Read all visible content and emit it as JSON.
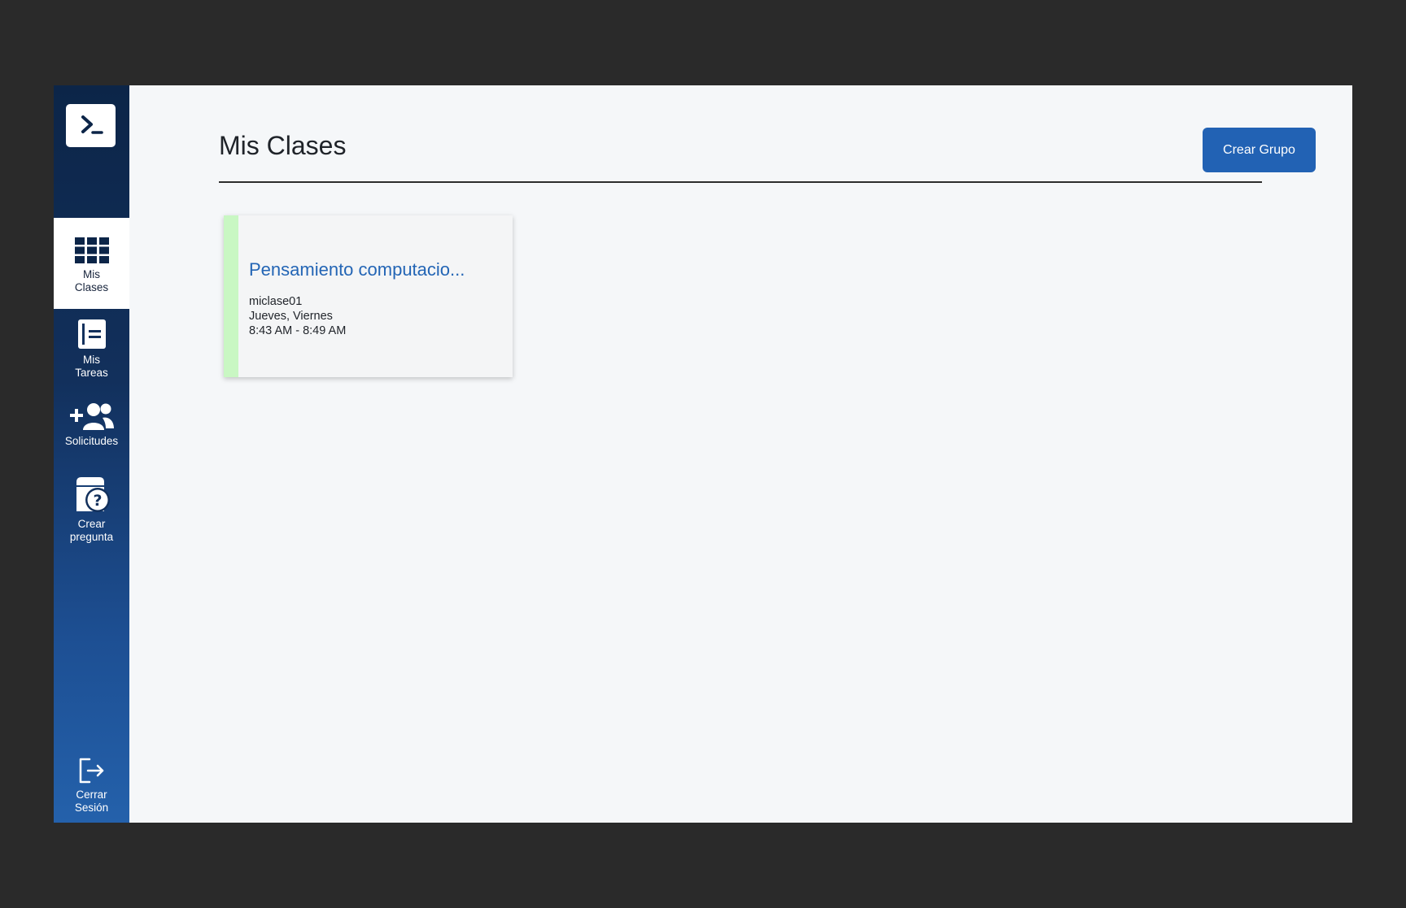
{
  "sidebar": {
    "items": [
      {
        "label": "Mis\nClases",
        "icon": "grid-icon",
        "active": true
      },
      {
        "label": "Mis\nTareas",
        "icon": "notebook-icon",
        "active": false
      },
      {
        "label": "Solicitudes",
        "icon": "add-users-icon",
        "active": false
      },
      {
        "label": "Crear\npregunta",
        "icon": "question-box-icon",
        "active": false
      }
    ],
    "logout_label": "Cerrar\nSesión",
    "logo_icon": "terminal-icon"
  },
  "main": {
    "title": "Mis Clases",
    "create_button": "Crear Grupo"
  },
  "classes": [
    {
      "name": "Pensamiento computacio...",
      "code": "miclase01",
      "days": "Jueves, Viernes",
      "time": "8:43 AM - 8:49 AM",
      "accent_color": "#c9f7c3"
    }
  ],
  "colors": {
    "sidebar_top": "#0c2548",
    "sidebar_bottom": "#2461ab",
    "primary": "#2262b4",
    "background": "#f5f7f9"
  }
}
